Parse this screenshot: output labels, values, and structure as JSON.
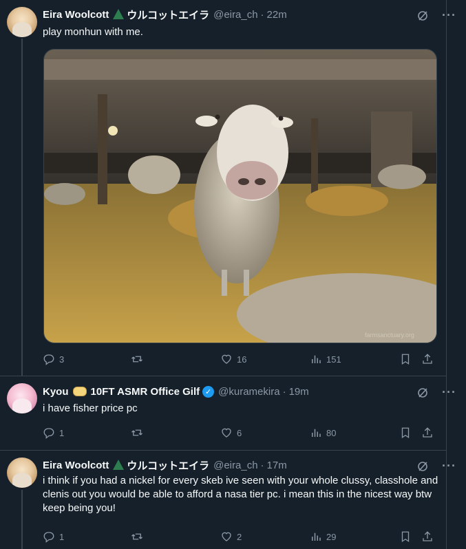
{
  "tweets": [
    {
      "display_name": "Eira Woolcott",
      "jp_name": "ウルコットエイラ",
      "handle": "@eira_ch",
      "time": "22m",
      "text": "play monhun with me.",
      "replies": "3",
      "retweets": "",
      "likes": "16",
      "views": "151",
      "media_watermark": "farmsanctuary.org"
    },
    {
      "display_name": "Kyou",
      "display_name_suffix": "10FT ASMR Office Gilf",
      "handle": "@kuramekira",
      "time": "19m",
      "text": "i have fisher price pc",
      "replies": "1",
      "retweets": "",
      "likes": "6",
      "views": "80"
    },
    {
      "display_name": "Eira Woolcott",
      "jp_name": "ウルコットエイラ",
      "handle": "@eira_ch",
      "time": "17m",
      "text": "i think if you had a nickel for every skeb ive seen with your whole clussy, classhole and clenis out you would be able to afford a nasa tier pc. i mean this in the nicest way btw keep being you!",
      "replies": "1",
      "retweets": "",
      "likes": "2",
      "views": "29"
    }
  ],
  "separator": "·",
  "verified_glyph": "✓",
  "colors": {
    "background": "#15202b",
    "border": "#38444d",
    "muted_text": "#8b98a5",
    "primary_text": "#f7f9f9",
    "verified_blue": "#1d9bf0",
    "badge_green": "#2e7d4f"
  },
  "icons": [
    "grok-icon",
    "more-icon",
    "reply-icon",
    "retweet-icon",
    "like-icon",
    "views-icon",
    "bookmark-icon",
    "share-icon",
    "verified-icon",
    "triangle-badge-icon",
    "emoji-roll-icon"
  ]
}
